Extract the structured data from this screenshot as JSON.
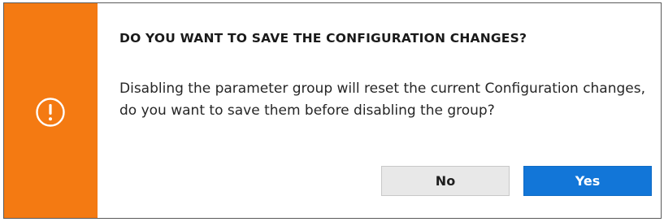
{
  "dialog": {
    "title": "DO YOU WANT TO SAVE THE CONFIGURATION CHANGES?",
    "message": "Disabling the parameter group will reset the current Configuration changes, do you want to save them before disabling the group?",
    "icon": "exclamation-circle-icon",
    "accent_color": "#f47a12",
    "buttons": {
      "no_label": "No",
      "yes_label": "Yes",
      "primary_color": "#1276d8"
    }
  }
}
